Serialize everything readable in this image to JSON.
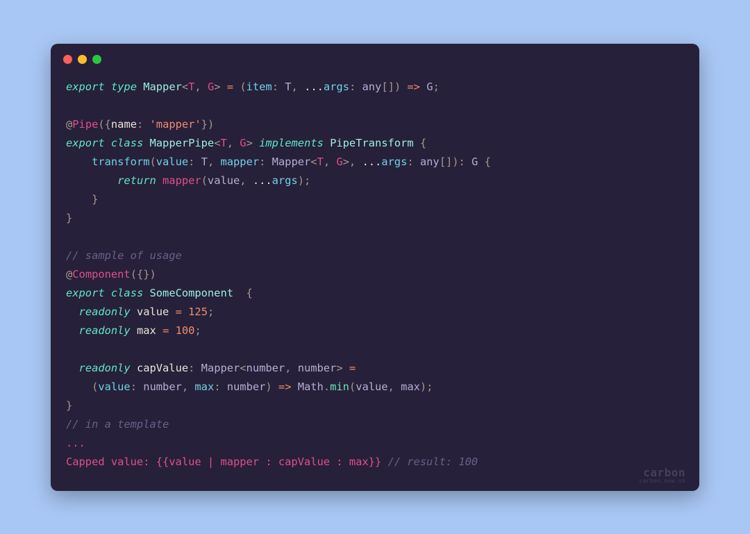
{
  "window": {
    "dots": [
      "red",
      "yellow",
      "green"
    ]
  },
  "tokens": {
    "export": "export",
    "type": "type",
    "class": "class",
    "implements": "implements",
    "return": "return",
    "readonly": "readonly",
    "Mapper": "Mapper",
    "MapperPipe": "MapperPipe",
    "PipeTransform": "PipeTransform",
    "SomeComponent": "SomeComponent",
    "item": "item",
    "args": "args",
    "any": "any",
    "T": "T",
    "G": "G",
    "Pipe": "Pipe",
    "Component": "Component",
    "name": "name",
    "mapper_str": "'mapper'",
    "transform": "transform",
    "value": "value",
    "mapper": "mapper",
    "capValue": "capValue",
    "max": "max",
    "number": "number",
    "Math": "Math",
    "min": "min",
    "n125": "125",
    "n100": "100",
    "cmt_usage": "// sample of usage",
    "cmt_template": "// in a template",
    "cmt_result": "// result: 100",
    "ellipsis": "...",
    "capped_label": "Capped value: ",
    "pipe": " | ",
    "colon_sp": " : "
  },
  "watermark": {
    "brand": "carbon",
    "url": "carbon.now.sh"
  }
}
